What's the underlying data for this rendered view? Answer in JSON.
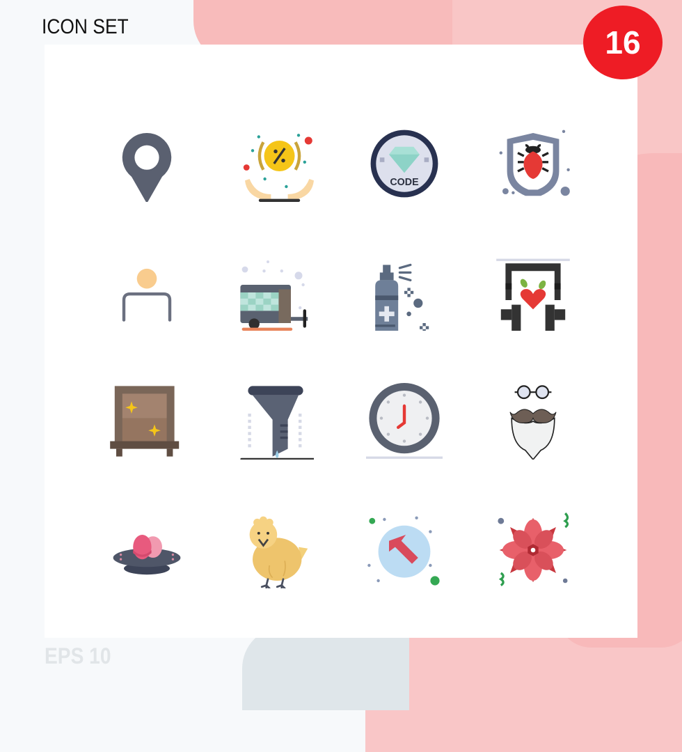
{
  "header": {
    "title": "ICON SET",
    "count_badge": "16"
  },
  "footer": {
    "format_label": "EPS 10"
  },
  "icons": [
    {
      "name": "location-pin"
    },
    {
      "name": "discount-in-hands"
    },
    {
      "name": "diamond-code-badge"
    },
    {
      "name": "shield-bug"
    },
    {
      "name": "user-profile"
    },
    {
      "name": "caravan-trailer"
    },
    {
      "name": "medical-spray"
    },
    {
      "name": "headphones-heart"
    },
    {
      "name": "cabinet-drawer"
    },
    {
      "name": "funnel-filter"
    },
    {
      "name": "wall-clock"
    },
    {
      "name": "hipster-beard-glasses"
    },
    {
      "name": "easter-eggs-nest"
    },
    {
      "name": "chick"
    },
    {
      "name": "up-left-arrow-circle"
    },
    {
      "name": "poinsettia-flower"
    }
  ],
  "colors": {
    "badge": "#ee1c25",
    "accent_pink": "#f8bbbb",
    "panel": "#ffffff"
  }
}
